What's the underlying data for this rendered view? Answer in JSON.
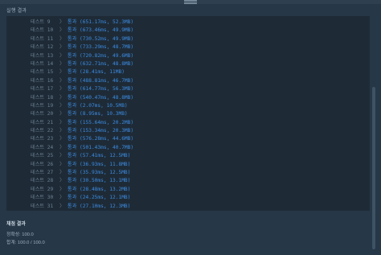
{
  "header": {
    "title": "실행 결과"
  },
  "results": [
    {
      "label": "테스트 9",
      "status": "통과",
      "detail": "(651.17ms, 52.3MB)"
    },
    {
      "label": "테스트 10",
      "status": "통과",
      "detail": "(673.46ms, 49.9MB)"
    },
    {
      "label": "테스트 11",
      "status": "통과",
      "detail": "(730.52ms, 49.9MB)"
    },
    {
      "label": "테스트 12",
      "status": "통과",
      "detail": "(733.29ms, 48.7MB)"
    },
    {
      "label": "테스트 13",
      "status": "통과",
      "detail": "(720.82ms, 49.6MB)"
    },
    {
      "label": "테스트 14",
      "status": "통과",
      "detail": "(632.71ms, 48.8MB)"
    },
    {
      "label": "테스트 15",
      "status": "통과",
      "detail": "(28.41ms, 11MB)"
    },
    {
      "label": "테스트 16",
      "status": "통과",
      "detail": "(488.81ms, 46.7MB)"
    },
    {
      "label": "테스트 17",
      "status": "통과",
      "detail": "(614.77ms, 56.3MB)"
    },
    {
      "label": "테스트 18",
      "status": "통과",
      "detail": "(540.47ms, 48.8MB)"
    },
    {
      "label": "테스트 19",
      "status": "통과",
      "detail": "(2.07ms, 10.5MB)"
    },
    {
      "label": "테스트 20",
      "status": "통과",
      "detail": "(8.95ms, 10.3MB)"
    },
    {
      "label": "테스트 21",
      "status": "통과",
      "detail": "(155.64ms, 20.2MB)"
    },
    {
      "label": "테스트 22",
      "status": "통과",
      "detail": "(153.34ms, 20.3MB)"
    },
    {
      "label": "테스트 23",
      "status": "통과",
      "detail": "(576.28ms, 44.6MB)"
    },
    {
      "label": "테스트 24",
      "status": "통과",
      "detail": "(501.43ms, 40.7MB)"
    },
    {
      "label": "테스트 25",
      "status": "통과",
      "detail": "(57.41ms, 12.5MB)"
    },
    {
      "label": "테스트 26",
      "status": "통과",
      "detail": "(36.93ms, 11.8MB)"
    },
    {
      "label": "테스트 27",
      "status": "통과",
      "detail": "(35.93ms, 12.5MB)"
    },
    {
      "label": "테스트 28",
      "status": "통과",
      "detail": "(30.50ms, 13.1MB)"
    },
    {
      "label": "테스트 29",
      "status": "통과",
      "detail": "(28.48ms, 13.2MB)"
    },
    {
      "label": "테스트 30",
      "status": "통과",
      "detail": "(24.25ms, 12.1MB)"
    },
    {
      "label": "테스트 31",
      "status": "통과",
      "detail": "(27.10ms, 12.3MB)"
    }
  ],
  "summary": {
    "title": "채점 결과",
    "accuracy": "정확성: 100.0",
    "total": "합계: 100.0 / 100.0"
  }
}
